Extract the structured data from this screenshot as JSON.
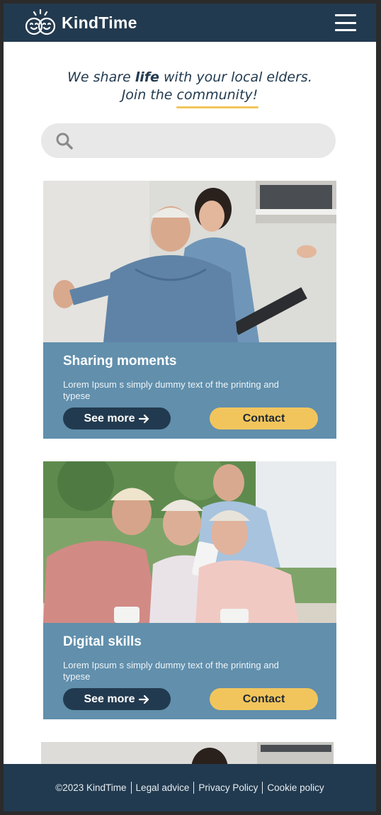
{
  "header": {
    "brand": "KindTime",
    "menu_icon": "hamburger-menu-icon"
  },
  "hero": {
    "line1_pre": "We share ",
    "line1_bold": "life",
    "line1_post": " with your local elders.",
    "line2_pre": "Join the ",
    "line2_underlined": "community!"
  },
  "search": {
    "icon": "search-icon",
    "value": "",
    "placeholder": ""
  },
  "cards": [
    {
      "title": "Sharing moments",
      "text": "Lorem Ipsum s simply dummy text of the printing and typese",
      "see_more": "See more",
      "see_more_icon": "arrow-right-icon",
      "contact": "Contact"
    },
    {
      "title": "Digital skills",
      "text": "Lorem Ipsum s simply dummy text of the printing and typese",
      "see_more": "See more",
      "see_more_icon": "arrow-right-icon",
      "contact": "Contact"
    }
  ],
  "footer": {
    "copyright": "©2023 KindTime",
    "links": [
      "Legal advice",
      "Privacy Policy",
      "Cookie policy"
    ]
  },
  "colors": {
    "header_bg": "#223a4f",
    "card_body": "#618fac",
    "accent_yellow": "#f2c55c",
    "search_bg": "#e8e8e8"
  }
}
